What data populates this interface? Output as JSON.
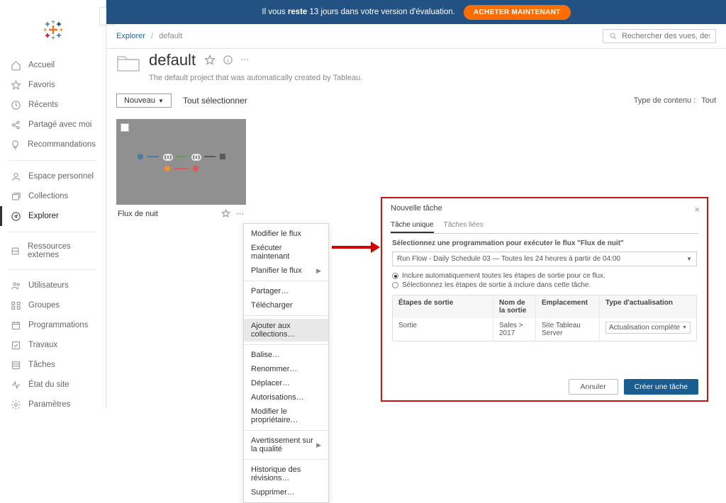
{
  "trial": {
    "message_pre": "Il vous ",
    "message_bold": "reste",
    "message_post": " 13 jours dans votre version d'évaluation.",
    "buy_label": "ACHETER MAINTENANT"
  },
  "breadcrumb": {
    "root": "Explorer",
    "current": "default"
  },
  "search": {
    "placeholder": "Rechercher des vues, des métriques"
  },
  "project": {
    "title": "default",
    "description": "The default project that was automatically created by Tableau."
  },
  "toolbar": {
    "new_label": "Nouveau",
    "select_all_label": "Tout sélectionner",
    "content_type_label": "Type de contenu :",
    "content_type_value": "Tout"
  },
  "sidebar": {
    "items": [
      {
        "label": "Accueil"
      },
      {
        "label": "Favoris"
      },
      {
        "label": "Récents"
      },
      {
        "label": "Partagé avec moi"
      },
      {
        "label": "Recommandations"
      },
      {
        "label": "Espace personnel"
      },
      {
        "label": "Collections"
      },
      {
        "label": "Explorer"
      },
      {
        "label": "Ressources externes"
      },
      {
        "label": "Utilisateurs"
      },
      {
        "label": "Groupes"
      },
      {
        "label": "Programmations"
      },
      {
        "label": "Travaux"
      },
      {
        "label": "Tâches"
      },
      {
        "label": "État du site"
      },
      {
        "label": "Paramètres"
      }
    ]
  },
  "flow_card": {
    "name": "Flux de nuit"
  },
  "context_menu": {
    "edit_flow": "Modifier le flux",
    "run_now": "Exécuter maintenant",
    "schedule_flow": "Planifier le flux",
    "share": "Partager…",
    "download": "Télécharger",
    "add_to_collections": "Ajouter aux collections…",
    "tag": "Balise…",
    "rename": "Renommer…",
    "move": "Déplacer…",
    "permissions": "Autorisations…",
    "change_owner": "Modifier le propriétaire…",
    "quality_warning": "Avertissement sur la qualité",
    "revision_history": "Historique des révisions…",
    "delete": "Supprimer…"
  },
  "dialog": {
    "title": "Nouvelle tâche",
    "tabs": {
      "single": "Tâche unique",
      "linked": "Tâches liées"
    },
    "subtitle_pre": "Sélectionnez une programmation pour exécuter le flux ",
    "subtitle_flow": "\"Flux de nuit\"",
    "schedule_value": "Run Flow - Daily Schedule 03 — Toutes les 24 heures à partir de 04:00",
    "radio_auto": "Inclure automatiquement toutes les étapes de sortie pour ce flux.",
    "radio_manual": "Sélectionnez les étapes de sortie à inclure dans cette tâche.",
    "table": {
      "col_output_steps": "Étapes de sortie",
      "col_output_name": "Nom de la sortie",
      "col_location": "Emplacement",
      "col_refresh_type": "Type d'actualisation",
      "row1": {
        "step": "Sortie",
        "name": "Sales > 2017",
        "location": "Site Tableau Server",
        "refresh": "Actualisation complète"
      }
    },
    "cancel": "Annuler",
    "submit": "Créer une tâche"
  }
}
